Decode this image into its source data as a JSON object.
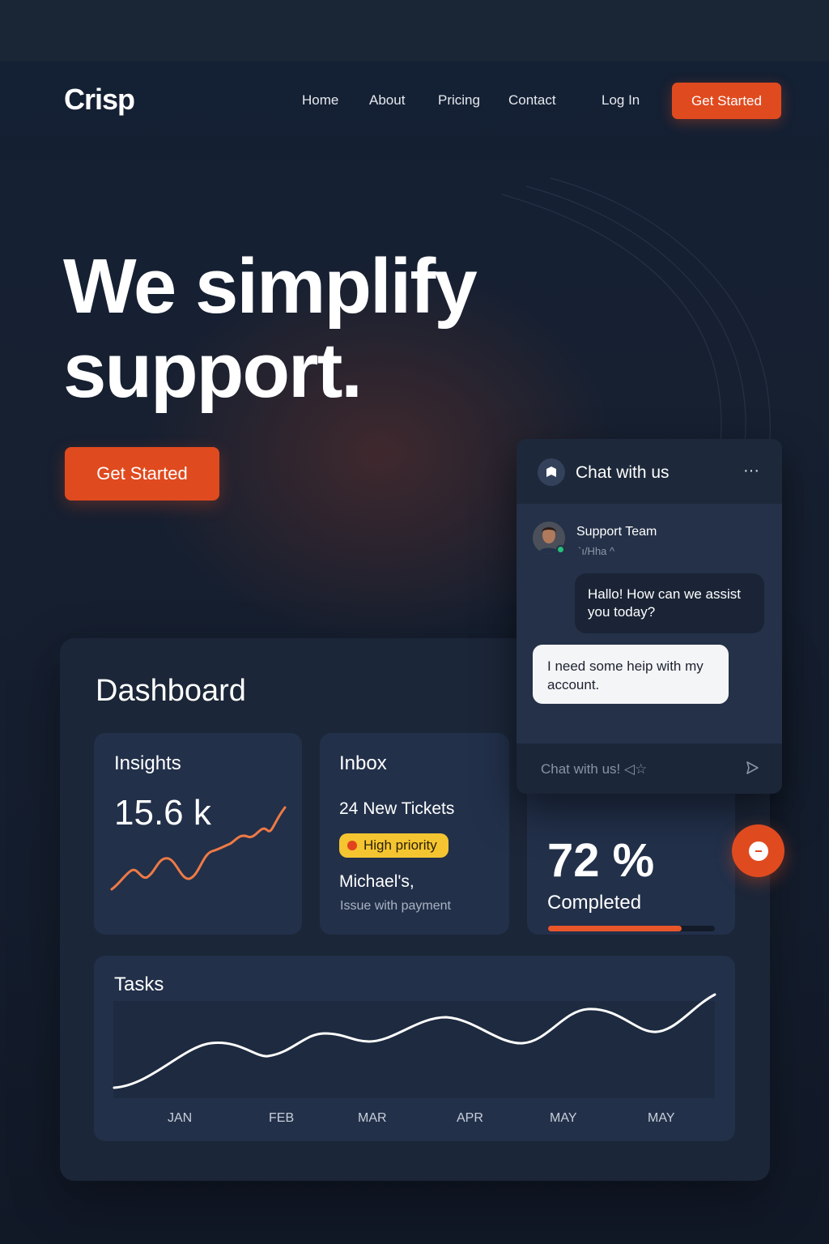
{
  "brand": {
    "name": "Crisp",
    "accent": "#e04a1f"
  },
  "nav": {
    "links": [
      "Home",
      "About",
      "Pricing",
      "Contact"
    ],
    "login": "Log In",
    "cta": "Get Started"
  },
  "hero": {
    "title_line1": "We simplify",
    "title_line2": "support.",
    "cta": "Get Started"
  },
  "dashboard": {
    "title": "Dashboard",
    "insights": {
      "title": "Insights",
      "value": "15.6 k"
    },
    "inbox": {
      "title": "Inbox",
      "tickets": "24  New Tickets",
      "badge": "High priority",
      "name": "Michael's,",
      "issue": "Issue with payment"
    },
    "completion": {
      "value": "72 %",
      "label": "Completed",
      "progress": 0.8
    },
    "tasks": {
      "title": "Tasks",
      "months": [
        "JAN",
        "FEB",
        "MAR",
        "APR",
        "MAY",
        "MAY"
      ]
    }
  },
  "chat": {
    "title": "Chat with us",
    "more": "···",
    "agent_name": "Support Team",
    "agent_status": "`ı/Hha ^",
    "agent_message": "Hallo! How can we assist you today?",
    "user_message": "I need some heip with my account.",
    "input_placeholder": "Chat with us! ◁☆"
  },
  "icons": {
    "chat_logo": "chat-logo-icon",
    "send": "send-icon",
    "fab": "minus-icon"
  }
}
